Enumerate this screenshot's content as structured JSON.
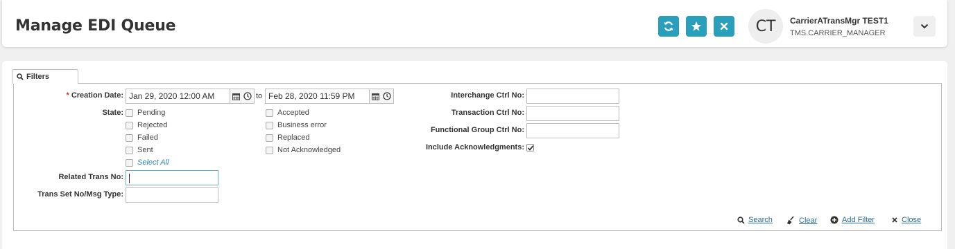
{
  "header": {
    "title": "Manage EDI Queue",
    "buttons": {
      "refresh_icon": "refresh-icon",
      "favorite_icon": "star-icon",
      "close_icon": "close-icon"
    },
    "user": {
      "initials": "CT",
      "name": "CarrierATransMgr TEST1",
      "role": "TMS.CARRIER_MANAGER"
    },
    "accent_color": "#2a9fbc"
  },
  "filters": {
    "tab_label": "Filters",
    "creation_date": {
      "label": "Creation Date:",
      "from_value": "Jan 29, 2020 12:00 AM",
      "to_label": "to",
      "to_value": "Feb 28, 2020 11:59 PM"
    },
    "state": {
      "label": "State:",
      "options_left": [
        {
          "label": "Pending",
          "checked": false
        },
        {
          "label": "Rejected",
          "checked": false
        },
        {
          "label": "Failed",
          "checked": false
        },
        {
          "label": "Sent",
          "checked": false
        }
      ],
      "options_right": [
        {
          "label": "Accepted",
          "checked": false
        },
        {
          "label": "Business error",
          "checked": false
        },
        {
          "label": "Replaced",
          "checked": false
        },
        {
          "label": "Not Acknowledged",
          "checked": false
        }
      ],
      "select_all": "Select All"
    },
    "related_trans_no": {
      "label": "Related Trans No:",
      "value": ""
    },
    "trans_set_no": {
      "label": "Trans Set No/Msg Type:",
      "value": ""
    },
    "interchange_ctrl_no": {
      "label": "Interchange Ctrl No:",
      "value": ""
    },
    "transaction_ctrl_no": {
      "label": "Transaction Ctrl No:",
      "value": ""
    },
    "functional_group_ctrl_no": {
      "label": "Functional Group Ctrl No:",
      "value": ""
    },
    "include_acknowledgments": {
      "label": "Include Acknowledgments:",
      "checked": true
    }
  },
  "actions": {
    "search": "Search",
    "clear": "Clear",
    "add_filter": "Add Filter",
    "close": "Close"
  }
}
